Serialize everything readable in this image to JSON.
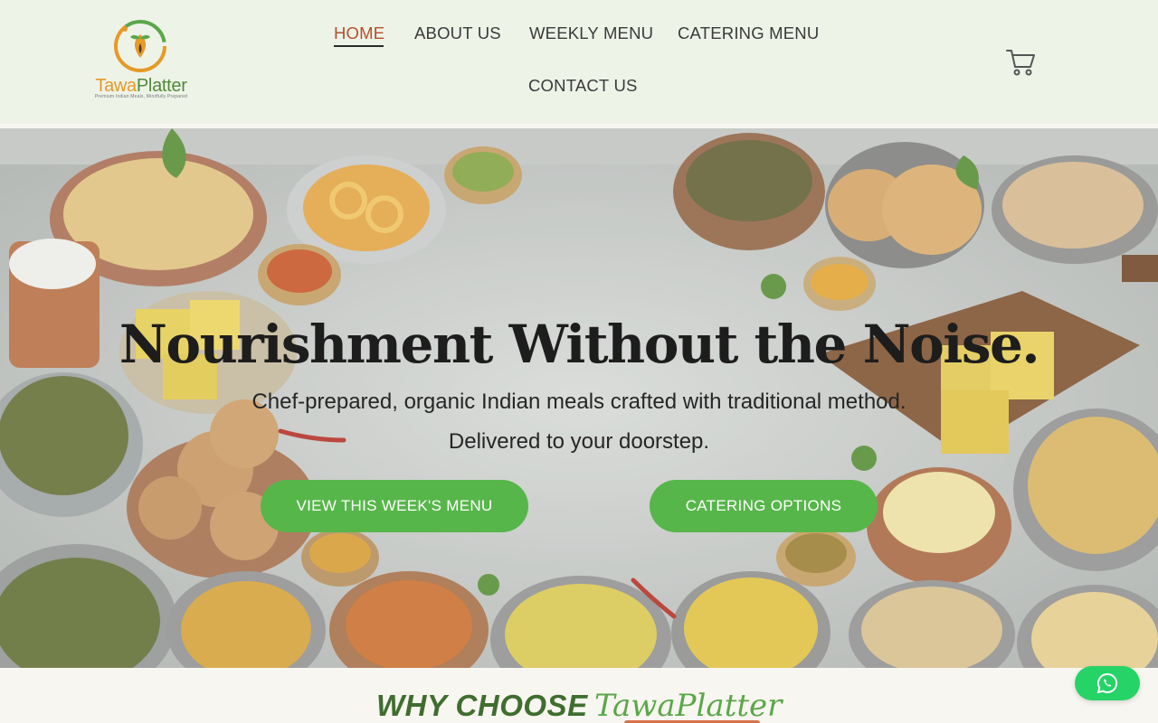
{
  "brand": {
    "name_part1": "Tawa",
    "name_part2": "Platter",
    "tagline": "Premium Indian Meals, Mindfully Prepared"
  },
  "nav": {
    "items": [
      {
        "label": "HOME",
        "active": true
      },
      {
        "label": "ABOUT US"
      },
      {
        "label": "WEEKLY MENU"
      },
      {
        "label": "CATERING MENU"
      },
      {
        "label": "CONTACT US"
      }
    ]
  },
  "hero": {
    "title": "Nourishment Without the Noise.",
    "subtitle_line1": "Chef-prepared, organic Indian meals crafted with traditional method.",
    "subtitle_line2": "Delivered to your doorstep.",
    "primary_button": "VIEW THIS WEEK'S MENU",
    "secondary_button": "CATERING OPTIONS"
  },
  "why": {
    "heading_part1": "WHY CHOOSE",
    "heading_part2": "TawaPlatter"
  },
  "colors": {
    "header_bg": "#eef3e8",
    "nav_active": "#b5502a",
    "button_green": "#57b64a",
    "heading_green": "#3f6e2f",
    "whatsapp": "#25d366"
  },
  "icons": {
    "cart": "shopping-cart-icon",
    "whatsapp": "whatsapp-icon"
  }
}
